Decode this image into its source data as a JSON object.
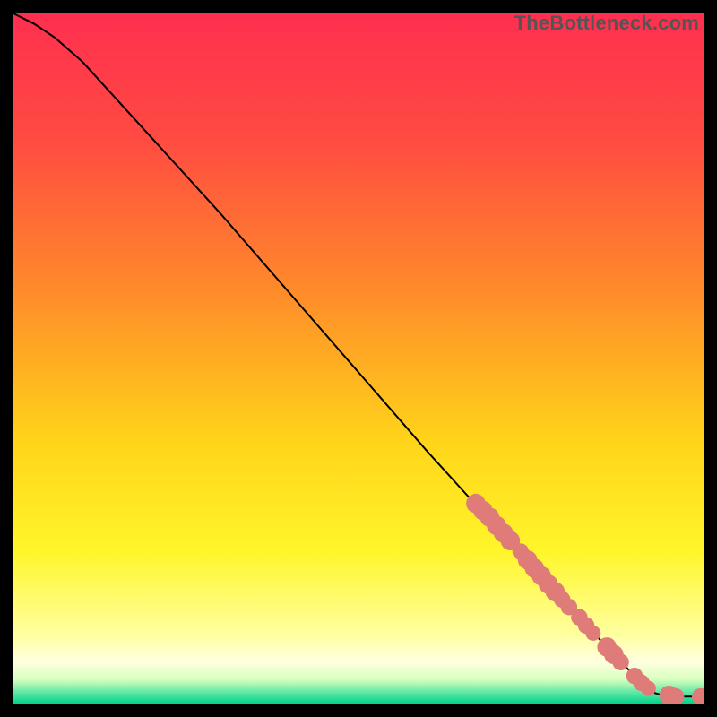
{
  "watermark": "TheBottleneck.com",
  "chart_data": {
    "type": "line",
    "title": "",
    "xlabel": "",
    "ylabel": "",
    "xlim": [
      0,
      100
    ],
    "ylim": [
      0,
      100
    ],
    "background_gradient_stops": [
      {
        "offset": 0.0,
        "color": "#ff2f4f"
      },
      {
        "offset": 0.18,
        "color": "#ff4a42"
      },
      {
        "offset": 0.4,
        "color": "#ff8a2a"
      },
      {
        "offset": 0.62,
        "color": "#ffd41a"
      },
      {
        "offset": 0.78,
        "color": "#fff62a"
      },
      {
        "offset": 0.9,
        "color": "#ffffa0"
      },
      {
        "offset": 0.94,
        "color": "#ffffe0"
      },
      {
        "offset": 0.965,
        "color": "#d8ffbf"
      },
      {
        "offset": 0.985,
        "color": "#58e6a3"
      },
      {
        "offset": 1.0,
        "color": "#00d38a"
      }
    ],
    "series": [
      {
        "name": "curve",
        "points": [
          {
            "x": 0.0,
            "y": 100.0
          },
          {
            "x": 3.0,
            "y": 98.5
          },
          {
            "x": 6.0,
            "y": 96.5
          },
          {
            "x": 10.0,
            "y": 93.0
          },
          {
            "x": 20.0,
            "y": 82.0
          },
          {
            "x": 30.0,
            "y": 71.0
          },
          {
            "x": 40.0,
            "y": 59.5
          },
          {
            "x": 50.0,
            "y": 48.0
          },
          {
            "x": 60.0,
            "y": 36.5
          },
          {
            "x": 70.0,
            "y": 25.5
          },
          {
            "x": 80.0,
            "y": 14.5
          },
          {
            "x": 90.0,
            "y": 4.0
          },
          {
            "x": 93.0,
            "y": 1.5
          },
          {
            "x": 95.0,
            "y": 1.0
          },
          {
            "x": 97.0,
            "y": 1.0
          },
          {
            "x": 98.5,
            "y": 1.0
          },
          {
            "x": 100.0,
            "y": 1.0
          }
        ]
      },
      {
        "name": "markers",
        "color": "#df7b78",
        "points": [
          {
            "x": 67.0,
            "y": 29.0,
            "r": 1.4
          },
          {
            "x": 68.0,
            "y": 28.0,
            "r": 1.4
          },
          {
            "x": 69.0,
            "y": 27.0,
            "r": 1.4
          },
          {
            "x": 70.0,
            "y": 25.8,
            "r": 1.4
          },
          {
            "x": 71.0,
            "y": 24.7,
            "r": 1.4
          },
          {
            "x": 72.0,
            "y": 23.6,
            "r": 1.4
          },
          {
            "x": 73.5,
            "y": 22.0,
            "r": 1.2
          },
          {
            "x": 74.5,
            "y": 20.8,
            "r": 1.4
          },
          {
            "x": 75.5,
            "y": 19.6,
            "r": 1.4
          },
          {
            "x": 76.5,
            "y": 18.5,
            "r": 1.4
          },
          {
            "x": 77.5,
            "y": 17.3,
            "r": 1.4
          },
          {
            "x": 78.5,
            "y": 16.2,
            "r": 1.4
          },
          {
            "x": 79.5,
            "y": 15.1,
            "r": 1.2
          },
          {
            "x": 80.5,
            "y": 14.0,
            "r": 1.2
          },
          {
            "x": 82.0,
            "y": 12.5,
            "r": 1.2
          },
          {
            "x": 83.0,
            "y": 11.3,
            "r": 1.2
          },
          {
            "x": 84.0,
            "y": 10.2,
            "r": 1.1
          },
          {
            "x": 86.0,
            "y": 8.2,
            "r": 1.4
          },
          {
            "x": 87.0,
            "y": 7.1,
            "r": 1.4
          },
          {
            "x": 88.0,
            "y": 6.0,
            "r": 1.2
          },
          {
            "x": 90.0,
            "y": 4.0,
            "r": 1.2
          },
          {
            "x": 91.0,
            "y": 3.0,
            "r": 1.2
          },
          {
            "x": 92.0,
            "y": 2.2,
            "r": 1.1
          },
          {
            "x": 95.0,
            "y": 1.2,
            "r": 1.4
          },
          {
            "x": 96.0,
            "y": 1.0,
            "r": 1.2
          },
          {
            "x": 99.5,
            "y": 1.0,
            "r": 1.2
          },
          {
            "x": 100.0,
            "y": 1.0,
            "r": 1.2
          }
        ]
      }
    ]
  }
}
